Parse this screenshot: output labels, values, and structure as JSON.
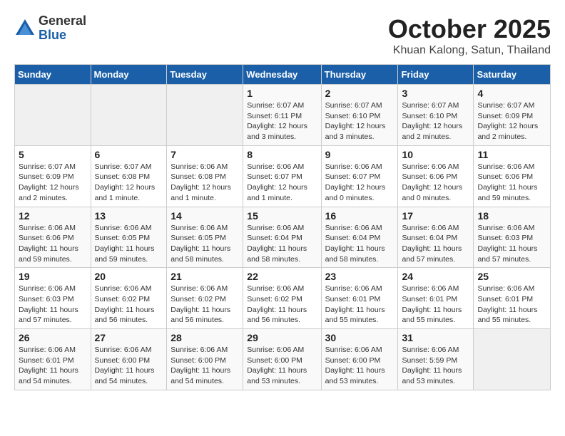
{
  "logo": {
    "general": "General",
    "blue": "Blue"
  },
  "title": "October 2025",
  "subtitle": "Khuan Kalong, Satun, Thailand",
  "weekdays": [
    "Sunday",
    "Monday",
    "Tuesday",
    "Wednesday",
    "Thursday",
    "Friday",
    "Saturday"
  ],
  "weeks": [
    [
      {
        "day": "",
        "info": ""
      },
      {
        "day": "",
        "info": ""
      },
      {
        "day": "",
        "info": ""
      },
      {
        "day": "1",
        "info": "Sunrise: 6:07 AM\nSunset: 6:11 PM\nDaylight: 12 hours and 3 minutes."
      },
      {
        "day": "2",
        "info": "Sunrise: 6:07 AM\nSunset: 6:10 PM\nDaylight: 12 hours and 3 minutes."
      },
      {
        "day": "3",
        "info": "Sunrise: 6:07 AM\nSunset: 6:10 PM\nDaylight: 12 hours and 2 minutes."
      },
      {
        "day": "4",
        "info": "Sunrise: 6:07 AM\nSunset: 6:09 PM\nDaylight: 12 hours and 2 minutes."
      }
    ],
    [
      {
        "day": "5",
        "info": "Sunrise: 6:07 AM\nSunset: 6:09 PM\nDaylight: 12 hours and 2 minutes."
      },
      {
        "day": "6",
        "info": "Sunrise: 6:07 AM\nSunset: 6:08 PM\nDaylight: 12 hours and 1 minute."
      },
      {
        "day": "7",
        "info": "Sunrise: 6:06 AM\nSunset: 6:08 PM\nDaylight: 12 hours and 1 minute."
      },
      {
        "day": "8",
        "info": "Sunrise: 6:06 AM\nSunset: 6:07 PM\nDaylight: 12 hours and 1 minute."
      },
      {
        "day": "9",
        "info": "Sunrise: 6:06 AM\nSunset: 6:07 PM\nDaylight: 12 hours and 0 minutes."
      },
      {
        "day": "10",
        "info": "Sunrise: 6:06 AM\nSunset: 6:06 PM\nDaylight: 12 hours and 0 minutes."
      },
      {
        "day": "11",
        "info": "Sunrise: 6:06 AM\nSunset: 6:06 PM\nDaylight: 11 hours and 59 minutes."
      }
    ],
    [
      {
        "day": "12",
        "info": "Sunrise: 6:06 AM\nSunset: 6:06 PM\nDaylight: 11 hours and 59 minutes."
      },
      {
        "day": "13",
        "info": "Sunrise: 6:06 AM\nSunset: 6:05 PM\nDaylight: 11 hours and 59 minutes."
      },
      {
        "day": "14",
        "info": "Sunrise: 6:06 AM\nSunset: 6:05 PM\nDaylight: 11 hours and 58 minutes."
      },
      {
        "day": "15",
        "info": "Sunrise: 6:06 AM\nSunset: 6:04 PM\nDaylight: 11 hours and 58 minutes."
      },
      {
        "day": "16",
        "info": "Sunrise: 6:06 AM\nSunset: 6:04 PM\nDaylight: 11 hours and 58 minutes."
      },
      {
        "day": "17",
        "info": "Sunrise: 6:06 AM\nSunset: 6:04 PM\nDaylight: 11 hours and 57 minutes."
      },
      {
        "day": "18",
        "info": "Sunrise: 6:06 AM\nSunset: 6:03 PM\nDaylight: 11 hours and 57 minutes."
      }
    ],
    [
      {
        "day": "19",
        "info": "Sunrise: 6:06 AM\nSunset: 6:03 PM\nDaylight: 11 hours and 57 minutes."
      },
      {
        "day": "20",
        "info": "Sunrise: 6:06 AM\nSunset: 6:02 PM\nDaylight: 11 hours and 56 minutes."
      },
      {
        "day": "21",
        "info": "Sunrise: 6:06 AM\nSunset: 6:02 PM\nDaylight: 11 hours and 56 minutes."
      },
      {
        "day": "22",
        "info": "Sunrise: 6:06 AM\nSunset: 6:02 PM\nDaylight: 11 hours and 56 minutes."
      },
      {
        "day": "23",
        "info": "Sunrise: 6:06 AM\nSunset: 6:01 PM\nDaylight: 11 hours and 55 minutes."
      },
      {
        "day": "24",
        "info": "Sunrise: 6:06 AM\nSunset: 6:01 PM\nDaylight: 11 hours and 55 minutes."
      },
      {
        "day": "25",
        "info": "Sunrise: 6:06 AM\nSunset: 6:01 PM\nDaylight: 11 hours and 55 minutes."
      }
    ],
    [
      {
        "day": "26",
        "info": "Sunrise: 6:06 AM\nSunset: 6:01 PM\nDaylight: 11 hours and 54 minutes."
      },
      {
        "day": "27",
        "info": "Sunrise: 6:06 AM\nSunset: 6:00 PM\nDaylight: 11 hours and 54 minutes."
      },
      {
        "day": "28",
        "info": "Sunrise: 6:06 AM\nSunset: 6:00 PM\nDaylight: 11 hours and 54 minutes."
      },
      {
        "day": "29",
        "info": "Sunrise: 6:06 AM\nSunset: 6:00 PM\nDaylight: 11 hours and 53 minutes."
      },
      {
        "day": "30",
        "info": "Sunrise: 6:06 AM\nSunset: 6:00 PM\nDaylight: 11 hours and 53 minutes."
      },
      {
        "day": "31",
        "info": "Sunrise: 6:06 AM\nSunset: 5:59 PM\nDaylight: 11 hours and 53 minutes."
      },
      {
        "day": "",
        "info": ""
      }
    ]
  ]
}
